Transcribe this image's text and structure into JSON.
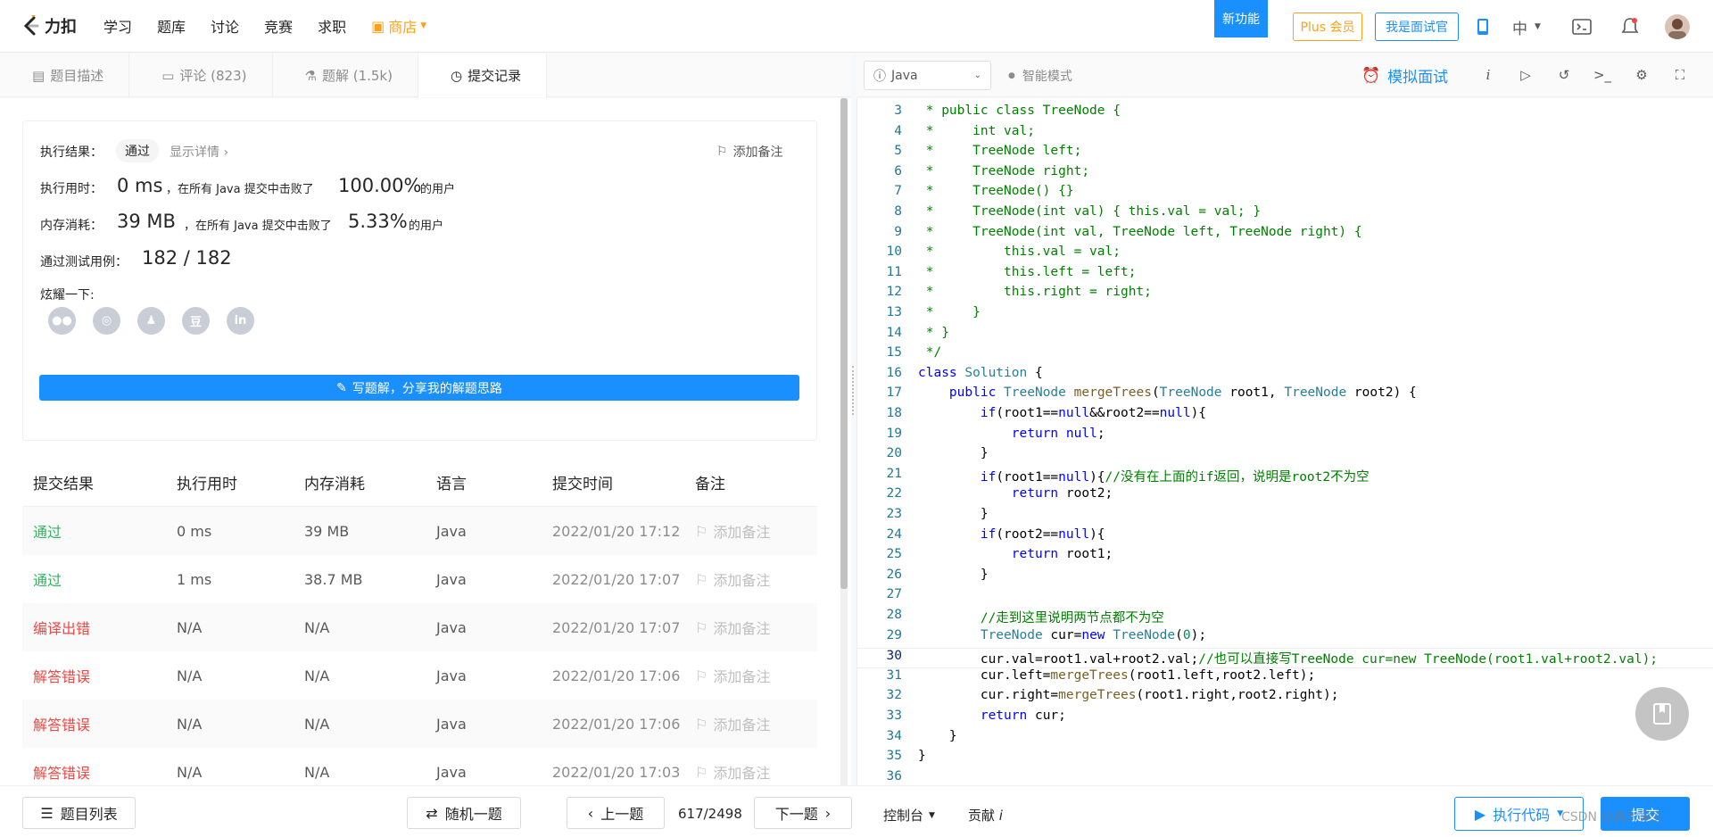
{
  "nav": {
    "logo_text": "力扣",
    "items": [
      "学习",
      "题库",
      "讨论",
      "竞赛",
      "求职"
    ],
    "shop": "商店",
    "new_feature": "新功能",
    "plus": "Plus 会员",
    "interviewer": "我是面试官",
    "lang": "中"
  },
  "tabs": [
    {
      "label": "题目描述"
    },
    {
      "label": "评论 (823)"
    },
    {
      "label": "题解 (1.5k)"
    },
    {
      "label": "提交记录"
    }
  ],
  "result": {
    "exec_result_label": "执行结果：",
    "status": "通过",
    "show_details": "显示详情 ›",
    "add_note": "添加备注",
    "time_label": "执行用时：",
    "time_value": "0 ms",
    "time_desc": "，在所有 Java 提交中击败了",
    "time_percent": "100.00%",
    "users": "的用户",
    "mem_label": "内存消耗：",
    "mem_value": "39 MB",
    "mem_desc": "，在所有 Java 提交中击败了",
    "mem_percent": "5.33%",
    "tests_label": "通过测试用例：",
    "tests_value": "182  /  182",
    "share_label": "炫耀一下:",
    "write_btn": "写题解，分享我的解题思路"
  },
  "submissions": {
    "headers": [
      "提交结果",
      "执行用时",
      "内存消耗",
      "语言",
      "提交时间",
      "备注"
    ],
    "note_label": "添加备注",
    "rows": [
      {
        "status": "通过",
        "time": "0 ms",
        "mem": "39 MB",
        "lang": "Java",
        "date": "2022/01/20 17:12"
      },
      {
        "status": "通过",
        "time": "1 ms",
        "mem": "38.7 MB",
        "lang": "Java",
        "date": "2022/01/20 17:07"
      },
      {
        "status": "编译出错",
        "time": "N/A",
        "mem": "N/A",
        "lang": "Java",
        "date": "2022/01/20 17:07"
      },
      {
        "status": "解答错误",
        "time": "N/A",
        "mem": "N/A",
        "lang": "Java",
        "date": "2022/01/20 17:06"
      },
      {
        "status": "解答错误",
        "time": "N/A",
        "mem": "N/A",
        "lang": "Java",
        "date": "2022/01/20 17:06"
      },
      {
        "status": "解答错误",
        "time": "N/A",
        "mem": "N/A",
        "lang": "Java",
        "date": "2022/01/20 17:03"
      }
    ]
  },
  "editor": {
    "language": "Java",
    "smart_mode": "智能模式",
    "mock_interview": "模拟面试",
    "lines": [
      {
        "n": "3",
        "t": " * public class TreeNode {"
      },
      {
        "n": "4",
        "t": " *     int val;"
      },
      {
        "n": "5",
        "t": " *     TreeNode left;"
      },
      {
        "n": "6",
        "t": " *     TreeNode right;"
      },
      {
        "n": "7",
        "t": " *     TreeNode() {}"
      },
      {
        "n": "8",
        "t": " *     TreeNode(int val) { this.val = val; }"
      },
      {
        "n": "9",
        "t": " *     TreeNode(int val, TreeNode left, TreeNode right) {"
      },
      {
        "n": "10",
        "t": " *         this.val = val;"
      },
      {
        "n": "11",
        "t": " *         this.left = left;"
      },
      {
        "n": "12",
        "t": " *         this.right = right;"
      },
      {
        "n": "13",
        "t": " *     }"
      },
      {
        "n": "14",
        "t": " * }"
      },
      {
        "n": "15",
        "t": " */"
      },
      {
        "n": "16",
        "t": "class Solution {"
      },
      {
        "n": "17",
        "t": "    public TreeNode mergeTrees(TreeNode root1, TreeNode root2) {"
      },
      {
        "n": "18",
        "t": "        if(root1==null&&root2==null){"
      },
      {
        "n": "19",
        "t": "            return null;"
      },
      {
        "n": "20",
        "t": "        }"
      },
      {
        "n": "21",
        "t": "        if(root1==null){//没有在上面的if返回，说明是root2不为空"
      },
      {
        "n": "22",
        "t": "            return root2;"
      },
      {
        "n": "23",
        "t": "        }"
      },
      {
        "n": "24",
        "t": "        if(root2==null){"
      },
      {
        "n": "25",
        "t": "            return root1;"
      },
      {
        "n": "26",
        "t": "        }"
      },
      {
        "n": "27",
        "t": ""
      },
      {
        "n": "28",
        "t": "        //走到这里说明两节点都不为空"
      },
      {
        "n": "29",
        "t": "        TreeNode cur=new TreeNode(0);"
      },
      {
        "n": "30",
        "t": "        cur.val=root1.val+root2.val;//也可以直接写TreeNode cur=new TreeNode(root1.val+root2.val);"
      },
      {
        "n": "31",
        "t": "        cur.left=mergeTrees(root1.left,root2.left);"
      },
      {
        "n": "32",
        "t": "        cur.right=mergeTrees(root1.right,root2.right);"
      },
      {
        "n": "33",
        "t": "        return cur;"
      },
      {
        "n": "34",
        "t": "    }"
      },
      {
        "n": "35",
        "t": "}"
      },
      {
        "n": "36",
        "t": ""
      }
    ]
  },
  "bottom": {
    "problem_list": "题目列表",
    "random": "随机一题",
    "prev": "上一题",
    "page": "617/2498",
    "next": "下一题",
    "console": "控制台",
    "contribute": "贡献",
    "run": "执行代码",
    "submit": "提交"
  },
  "watermark": "CSDN @高木吴少"
}
